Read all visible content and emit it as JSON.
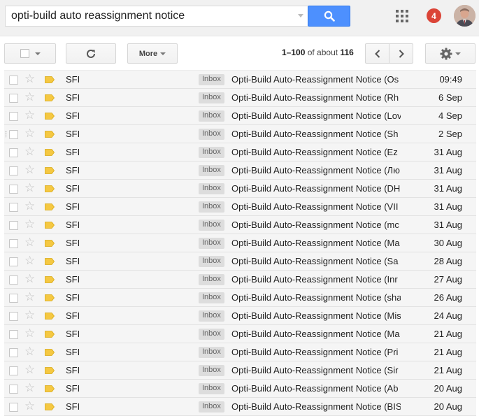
{
  "search": {
    "query": "opti-build auto reassignment notice"
  },
  "header": {
    "notification_count": "4"
  },
  "toolbar": {
    "more_label": "More",
    "range": "1–100",
    "of_about": "of about",
    "total": "116"
  },
  "colors": {
    "search_button": "#4d90fe",
    "badge": "#db4437",
    "label_tag": "#f5c842",
    "row_background": "#f5f5f5"
  },
  "messages": [
    {
      "sender": "SFI",
      "tag": "Inbox",
      "subject": "Opti-Build Auto-Reassignment Notice (Os",
      "date": "09:49"
    },
    {
      "sender": "SFI",
      "tag": "Inbox",
      "subject": "Opti-Build Auto-Reassignment Notice (Rh",
      "date": "6 Sep"
    },
    {
      "sender": "SFI",
      "tag": "Inbox",
      "subject": "Opti-Build Auto-Reassignment Notice (Lov",
      "date": "4 Sep"
    },
    {
      "sender": "SFI",
      "tag": "Inbox",
      "subject": "Opti-Build Auto-Reassignment Notice (Sh",
      "date": "2 Sep"
    },
    {
      "sender": "SFI",
      "tag": "Inbox",
      "subject": "Opti-Build Auto-Reassignment Notice (Ez",
      "date": "31 Aug"
    },
    {
      "sender": "SFI",
      "tag": "Inbox",
      "subject": "Opti-Build Auto-Reassignment Notice (Лю",
      "date": "31 Aug"
    },
    {
      "sender": "SFI",
      "tag": "Inbox",
      "subject": "Opti-Build Auto-Reassignment Notice (DH",
      "date": "31 Aug"
    },
    {
      "sender": "SFI",
      "tag": "Inbox",
      "subject": "Opti-Build Auto-Reassignment Notice (VII",
      "date": "31 Aug"
    },
    {
      "sender": "SFI",
      "tag": "Inbox",
      "subject": "Opti-Build Auto-Reassignment Notice (mc",
      "date": "31 Aug"
    },
    {
      "sender": "SFI",
      "tag": "Inbox",
      "subject": "Opti-Build Auto-Reassignment Notice (Ma",
      "date": "30 Aug"
    },
    {
      "sender": "SFI",
      "tag": "Inbox",
      "subject": "Opti-Build Auto-Reassignment Notice (Sa",
      "date": "28 Aug"
    },
    {
      "sender": "SFI",
      "tag": "Inbox",
      "subject": "Opti-Build Auto-Reassignment Notice (Inr",
      "date": "27 Aug"
    },
    {
      "sender": "SFI",
      "tag": "Inbox",
      "subject": "Opti-Build Auto-Reassignment Notice (sha",
      "date": "26 Aug"
    },
    {
      "sender": "SFI",
      "tag": "Inbox",
      "subject": "Opti-Build Auto-Reassignment Notice (Mis",
      "date": "24 Aug"
    },
    {
      "sender": "SFI",
      "tag": "Inbox",
      "subject": "Opti-Build Auto-Reassignment Notice (Ma",
      "date": "21 Aug"
    },
    {
      "sender": "SFI",
      "tag": "Inbox",
      "subject": "Opti-Build Auto-Reassignment Notice (Pri",
      "date": "21 Aug"
    },
    {
      "sender": "SFI",
      "tag": "Inbox",
      "subject": "Opti-Build Auto-Reassignment Notice (Sir",
      "date": "21 Aug"
    },
    {
      "sender": "SFI",
      "tag": "Inbox",
      "subject": "Opti-Build Auto-Reassignment Notice (Ab",
      "date": "20 Aug"
    },
    {
      "sender": "SFI",
      "tag": "Inbox",
      "subject": "Opti-Build Auto-Reassignment Notice (BIS",
      "date": "20 Aug"
    }
  ]
}
